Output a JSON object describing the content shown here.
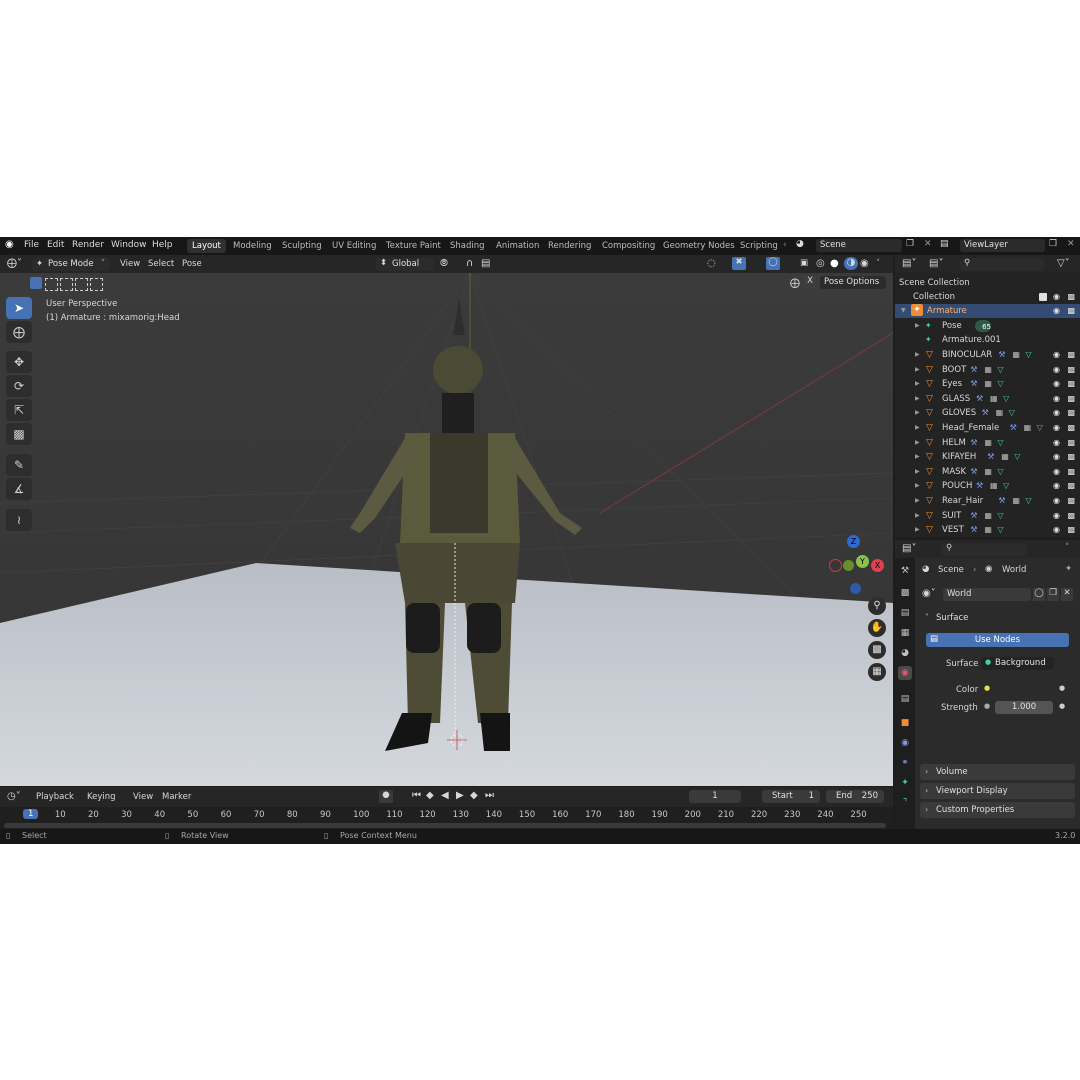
{
  "menu": [
    "File",
    "Edit",
    "Render",
    "Window",
    "Help"
  ],
  "workspaces": [
    "Layout",
    "Modeling",
    "Sculpting",
    "UV Editing",
    "Texture Paint",
    "Shading",
    "Animation",
    "Rendering",
    "Compositing",
    "Geometry Nodes",
    "Scripting"
  ],
  "scene": "Scene",
  "view_layer": "ViewLayer",
  "viewport": {
    "mode": "Pose Mode",
    "menus": [
      "View",
      "Select",
      "Pose"
    ],
    "transform_orientation": "Global",
    "pose_options": "Pose Options",
    "x_mirror": "X",
    "overlay_title": "User Perspective",
    "overlay_subtitle": "(1) Armature : mixamorig:Head",
    "gizmo": {
      "z": "Z",
      "y": "Y",
      "x": "X"
    }
  },
  "timeline": {
    "menus": [
      "Playback",
      "Keying",
      "View",
      "Marker"
    ],
    "current_frame": "1",
    "start_label": "Start",
    "start": "1",
    "end_label": "End",
    "end": "250",
    "ticks": [
      "1",
      "10",
      "20",
      "30",
      "40",
      "50",
      "60",
      "70",
      "80",
      "90",
      "100",
      "110",
      "120",
      "130",
      "140",
      "150",
      "160",
      "170",
      "180",
      "190",
      "200",
      "210",
      "220",
      "230",
      "240",
      "250"
    ]
  },
  "status": {
    "select": "Select",
    "rotate": "Rotate View",
    "context": "Pose Context Menu",
    "version": "3.2.0"
  },
  "outliner": {
    "scene_collection": "Scene Collection",
    "collection": "Collection",
    "armature": "Armature",
    "pose": "Pose",
    "pose_badge": "65",
    "armature_data": "Armature.001",
    "objects": [
      "BINOCULAR",
      "BOOT",
      "Eyes",
      "GLASS",
      "GLOVES",
      "Head_Female",
      "HELM",
      "KIFAYEH",
      "MASK",
      "POUCH",
      "Rear_Hair",
      "SUIT",
      "VEST"
    ]
  },
  "properties": {
    "breadcrumb_scene": "Scene",
    "breadcrumb_world": "World",
    "world_name": "World",
    "surface_panel": "Surface",
    "use_nodes": "Use Nodes",
    "surface_label": "Surface",
    "surface_value": "Background",
    "color_label": "Color",
    "strength_label": "Strength",
    "strength_value": "1.000",
    "panels": [
      "Volume",
      "Viewport Display",
      "Custom Properties"
    ]
  },
  "colors": {
    "accent": "#4772b3",
    "object": "#ee8d37",
    "mesh": "#3fd3a4",
    "selection": "#344b73"
  }
}
